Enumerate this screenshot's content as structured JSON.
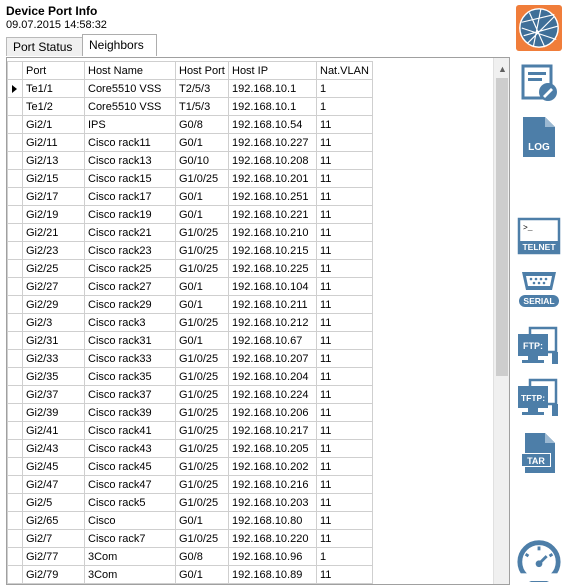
{
  "header": {
    "title": "Device Port Info",
    "timestamp": "09.07.2015 14:58:32"
  },
  "tabs": [
    {
      "label": "Port Status"
    },
    {
      "label": "Neighbors"
    }
  ],
  "grid": {
    "columns": [
      "Port",
      "Host Name",
      "Host Port",
      "Host IP",
      "Nat.VLAN"
    ],
    "rows": [
      [
        "Te1/1",
        "Core5510 VSS",
        "T2/5/3",
        "192.168.10.1",
        "1"
      ],
      [
        "Te1/2",
        "Core5510 VSS",
        "T1/5/3",
        "192.168.10.1",
        "1"
      ],
      [
        "Gi2/1",
        "IPS",
        "G0/8",
        "192.168.10.54",
        "11"
      ],
      [
        "Gi2/11",
        "Cisco rack11",
        "G0/1",
        "192.168.10.227",
        "11"
      ],
      [
        "Gi2/13",
        "Cisco rack13",
        "G0/10",
        "192.168.10.208",
        "11"
      ],
      [
        "Gi2/15",
        "Cisco rack15",
        "G1/0/25",
        "192.168.10.201",
        "11"
      ],
      [
        "Gi2/17",
        "Cisco rack17",
        "G0/1",
        "192.168.10.251",
        "11"
      ],
      [
        "Gi2/19",
        "Cisco rack19",
        "G0/1",
        "192.168.10.221",
        "11"
      ],
      [
        "Gi2/21",
        "Cisco rack21",
        "G1/0/25",
        "192.168.10.210",
        "11"
      ],
      [
        "Gi2/23",
        "Cisco rack23",
        "G1/0/25",
        "192.168.10.215",
        "11"
      ],
      [
        "Gi2/25",
        "Cisco rack25",
        "G1/0/25",
        "192.168.10.225",
        "11"
      ],
      [
        "Gi2/27",
        "Cisco rack27",
        "G0/1",
        "192.168.10.104",
        "11"
      ],
      [
        "Gi2/29",
        "Cisco rack29",
        "G0/1",
        "192.168.10.211",
        "11"
      ],
      [
        "Gi2/3",
        "Cisco rack3",
        "G1/0/25",
        "192.168.10.212",
        "11"
      ],
      [
        "Gi2/31",
        "Cisco rack31",
        "G0/1",
        "192.168.10.67",
        "11"
      ],
      [
        "Gi2/33",
        "Cisco rack33",
        "G1/0/25",
        "192.168.10.207",
        "11"
      ],
      [
        "Gi2/35",
        "Cisco rack35",
        "G1/0/25",
        "192.168.10.204",
        "11"
      ],
      [
        "Gi2/37",
        "Cisco rack37",
        "G1/0/25",
        "192.168.10.224",
        "11"
      ],
      [
        "Gi2/39",
        "Cisco rack39",
        "G1/0/25",
        "192.168.10.206",
        "11"
      ],
      [
        "Gi2/41",
        "Cisco rack41",
        "G1/0/25",
        "192.168.10.217",
        "11"
      ],
      [
        "Gi2/43",
        "Cisco rack43",
        "G1/0/25",
        "192.168.10.205",
        "11"
      ],
      [
        "Gi2/45",
        "Cisco rack45",
        "G1/0/25",
        "192.168.10.202",
        "11"
      ],
      [
        "Gi2/47",
        "Cisco rack47",
        "G1/0/25",
        "192.168.10.216",
        "11"
      ],
      [
        "Gi2/5",
        "Cisco rack5",
        "G1/0/25",
        "192.168.10.203",
        "11"
      ],
      [
        "Gi2/65",
        "Cisco",
        "G0/1",
        "192.168.10.80",
        "11"
      ],
      [
        "Gi2/7",
        "Cisco rack7",
        "G1/0/25",
        "192.168.10.220",
        "11"
      ],
      [
        "Gi2/77",
        "3Com",
        "G0/8",
        "192.168.10.96",
        "1"
      ],
      [
        "Gi2/79",
        "3Com",
        "G0/1",
        "192.168.10.89",
        "11"
      ]
    ]
  },
  "sidebar": {
    "items": [
      {
        "icon": "network-globe-icon"
      },
      {
        "icon": "edit-document-icon"
      },
      {
        "icon": "log-file-icon",
        "label": "LOG"
      },
      {
        "icon": "telnet-icon",
        "label": "TELNET"
      },
      {
        "icon": "serial-port-icon",
        "label": "SERIAL"
      },
      {
        "icon": "ftp-icon",
        "label": "FTP:"
      },
      {
        "icon": "tftp-icon",
        "label": "TFTP:"
      },
      {
        "icon": "tar-file-icon",
        "label": "TAR"
      },
      {
        "icon": "speedometer-icon"
      }
    ],
    "colors": {
      "brand": "#f07d3a",
      "icon_fill": "#4d7ea8"
    }
  }
}
